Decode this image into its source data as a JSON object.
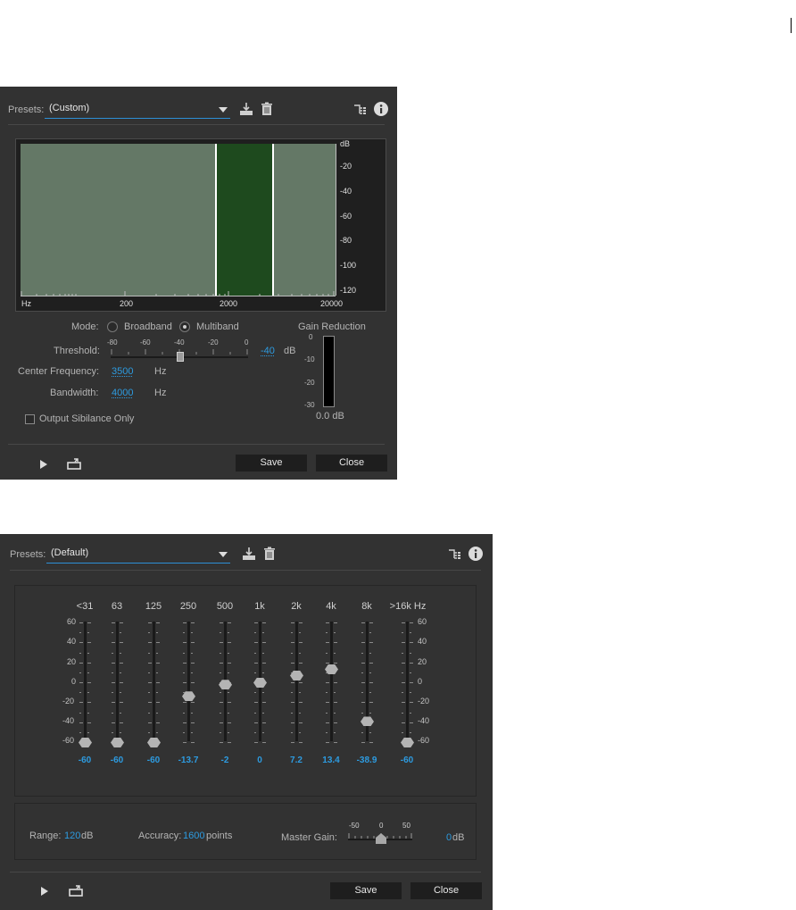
{
  "deesser": {
    "presets_label": "Presets:",
    "preset_value": "(Custom)",
    "spectrum": {
      "y_ticks": [
        "dB",
        "-20",
        "-40",
        "-60",
        "-80",
        "-100",
        "-120"
      ],
      "x_ticks": [
        "Hz",
        "200",
        "2000",
        "20000"
      ]
    },
    "mode_label": "Mode:",
    "mode_options": [
      "Broadband",
      "Multiband"
    ],
    "mode_selected": "Multiband",
    "threshold_label": "Threshold:",
    "threshold_scale": [
      "-80",
      "-60",
      "-40",
      "-20",
      "0"
    ],
    "threshold_value": "-40",
    "threshold_unit": "dB",
    "center_freq_label": "Center Frequency:",
    "center_freq_value": "3500",
    "center_freq_unit": "Hz",
    "bandwidth_label": "Bandwidth:",
    "bandwidth_value": "4000",
    "bandwidth_unit": "Hz",
    "output_sibilance_label": "Output Sibilance Only",
    "gain_reduction_label": "Gain Reduction",
    "gain_reduction_scale": [
      "0",
      "-10",
      "-20",
      "-30"
    ],
    "gain_reduction_value": "0.0 dB",
    "save_label": "Save",
    "close_label": "Close"
  },
  "eq": {
    "presets_label": "Presets:",
    "preset_value": "(Default)",
    "bands": [
      {
        "label": "<31",
        "value": "-60"
      },
      {
        "label": "63",
        "value": "-60"
      },
      {
        "label": "125",
        "value": "-60"
      },
      {
        "label": "250",
        "value": "-13.7"
      },
      {
        "label": "500",
        "value": "-2"
      },
      {
        "label": "1k",
        "value": "0"
      },
      {
        "label": "2k",
        "value": "7.2"
      },
      {
        "label": "4k",
        "value": "13.4"
      },
      {
        "label": "8k",
        "value": "-38.9"
      },
      {
        "label": ">16k Hz",
        "value": "-60"
      }
    ],
    "scale": [
      "60",
      "40",
      "20",
      "0",
      "-20",
      "-40",
      "-60"
    ],
    "range_label": "Range:",
    "range_value": "120",
    "range_unit": "dB",
    "accuracy_label": "Accuracy:",
    "accuracy_value": "1600",
    "accuracy_unit": "points",
    "master_gain_label": "Master Gain:",
    "master_gain_scale": [
      "-50",
      "0",
      "50"
    ],
    "master_gain_value": "0",
    "master_gain_unit": "dB",
    "save_label": "Save",
    "close_label": "Close"
  },
  "colors": {
    "panel_bg": "#323232",
    "accent_blue": "#2d9be0",
    "spectrum_bg": "#647866",
    "band_highlight": "#1e4a1e"
  }
}
